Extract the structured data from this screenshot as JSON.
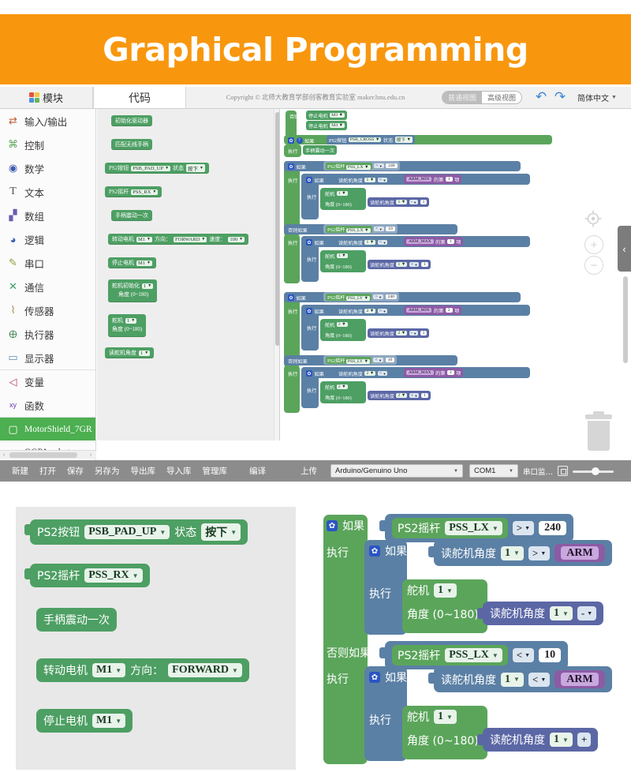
{
  "banner": {
    "title": "Graphical Programming",
    "bg": "#f8970e"
  },
  "app": {
    "tabs": [
      {
        "label": "模块",
        "icon": "puzzle-icon",
        "selected": false
      },
      {
        "label": "代码",
        "icon": "",
        "selected": true
      }
    ],
    "copyright": "Copyright © 北师大教育学部创客教育实验室 maker.bnu.edu.cn",
    "view_toggle": {
      "normal": "普通视图",
      "advanced": "高级视图",
      "selected": "普通视图"
    },
    "undo_icon": "undo-arrow-icon",
    "redo_icon": "redo-arrow-icon",
    "language": "简体中文"
  },
  "sidebar": {
    "items": [
      {
        "label": "输入/输出",
        "icon": "io-arrows-icon",
        "color": "#c0603a"
      },
      {
        "label": "控制",
        "icon": "gamepad-icon",
        "color": "#5ba55b"
      },
      {
        "label": "数学",
        "icon": "math-circle-icon",
        "color": "#3c5bb0"
      },
      {
        "label": "文本",
        "icon": "text-T-icon",
        "color": "#555555"
      },
      {
        "label": "数组",
        "icon": "array-blocks-icon",
        "color": "#6b5bb0"
      },
      {
        "label": "逻辑",
        "icon": "bulb-icon",
        "color": "#3c5bb0"
      },
      {
        "label": "串口",
        "icon": "pen-icon",
        "color": "#8d9b3c"
      },
      {
        "label": "通信",
        "icon": "wifi-icon",
        "color": "#3c9b6b"
      },
      {
        "label": "传感器",
        "icon": "sensor-icon",
        "color": "#b08a4a"
      },
      {
        "label": "执行器",
        "icon": "actuator-icon",
        "color": "#4a8a5a"
      },
      {
        "label": "显示器",
        "icon": "monitor-icon",
        "color": "#5a8ab0"
      },
      {
        "label": "变量",
        "icon": "variable-flag-icon",
        "color": "#b03c6b"
      },
      {
        "label": "函数",
        "icon": "function-xy-icon",
        "color": "#6b3cb0"
      }
    ],
    "libraries": [
      {
        "label": "MotorShield_7GR",
        "icon": "box-icon",
        "selected": true
      },
      {
        "label": "OGPArmbot",
        "icon": "colorbox-icon",
        "selected": false
      }
    ]
  },
  "palette": {
    "blocks": [
      {
        "text": "初始化驱动器"
      },
      {
        "text": "匹配无线手柄"
      },
      {
        "text": "PS2按钮",
        "fields": [
          "PSB_PAD_UP"
        ],
        "text2": "状态",
        "fields2": [
          "按下"
        ]
      },
      {
        "text": "PS2摇杆",
        "fields": [
          "PSS_RX"
        ]
      },
      {
        "text": "手柄震动一次"
      },
      {
        "text": "转动电机",
        "fields": [
          "M1"
        ],
        "text2": "方向：",
        "fields2": [
          "FORWARD"
        ],
        "text3": "速度：",
        "fields3": [
          "100"
        ]
      },
      {
        "text": "停止电机",
        "fields": [
          "M1"
        ]
      },
      {
        "text": "舵机初始化",
        "fields": [
          "1"
        ],
        "text2": "角度 (0~180)"
      },
      {
        "text": "舵机",
        "fields": [
          "1"
        ],
        "text2": "角度 (0~180)"
      },
      {
        "text": "读舵机角度",
        "fields": [
          "1"
        ]
      }
    ]
  },
  "workspace": {
    "labels": {
      "else": "否则",
      "if": "如果",
      "do": "执行",
      "elseif": "否则如果",
      "stop_motor": "停止电机",
      "ps2_button": "PS2按钮",
      "state": "状态",
      "pressed": "按下",
      "vibrate": "手柄震动一次",
      "ps2_stick": "PS2摇杆",
      "read_servo": "读舵机角度",
      "servo": "舵机",
      "angle": "角度 (0~180)",
      "item_of": "的第",
      "item_suffix": "项"
    },
    "values": {
      "m3": "M3",
      "m4": "M4",
      "psb_cross": "PSB_CROSS",
      "pss_lx": "PSS_LX",
      "pss_ly": "PSS_LY",
      "gt": ">",
      "lt": "<",
      "n240": "240",
      "n10": "10",
      "n1": "1",
      "n2": "2",
      "arm_min": "ARM_MIN",
      "arm_max": "ARM_MAX",
      "minus": "-",
      "plus": "+"
    },
    "controls": {
      "collapse_icon": "chevron-left-icon",
      "center_icon": "crosshair-target-icon",
      "zoom_in": "+",
      "zoom_out": "−",
      "trash_icon": "trash-can-icon"
    }
  },
  "toolbar": {
    "buttons": [
      "新建",
      "打开",
      "保存",
      "另存为",
      "导出库",
      "导入库",
      "管理库",
      "编译",
      "上传"
    ],
    "board": "Arduino/Genuino Uno",
    "port": "COM1",
    "serial_monitor": "串口监…",
    "chip_icon": "chip-icon",
    "slider_icon": "zoom-slider"
  },
  "magnified": {
    "left_blocks": [
      {
        "text": "PS2按钮",
        "fields": [
          "PSB_PAD_UP"
        ],
        "text2": "状态",
        "fields2": [
          "按下"
        ]
      },
      {
        "text": "PS2摇杆",
        "fields": [
          "PSS_RX"
        ]
      },
      {
        "text": "手柄震动一次"
      },
      {
        "text": "转动电机",
        "fields": [
          "M1"
        ],
        "text2": "方向：",
        "fields2": [
          "FORWARD"
        ]
      },
      {
        "text": "停止电机",
        "fields": [
          "M1"
        ]
      }
    ],
    "right": {
      "if": "如果",
      "do": "执行",
      "elseif": "否则如果",
      "ps2_stick": "PS2摇杆",
      "pss_lx": "PSS_LX",
      "read_servo": "读舵机角度",
      "servo": "舵机",
      "angle": "角度 (0~180)",
      "gt": ">",
      "lt": "<",
      "n240": "240",
      "n10": "10",
      "n1": "1",
      "arm_label": "ARM",
      "minus": "-",
      "plus": "+"
    }
  }
}
